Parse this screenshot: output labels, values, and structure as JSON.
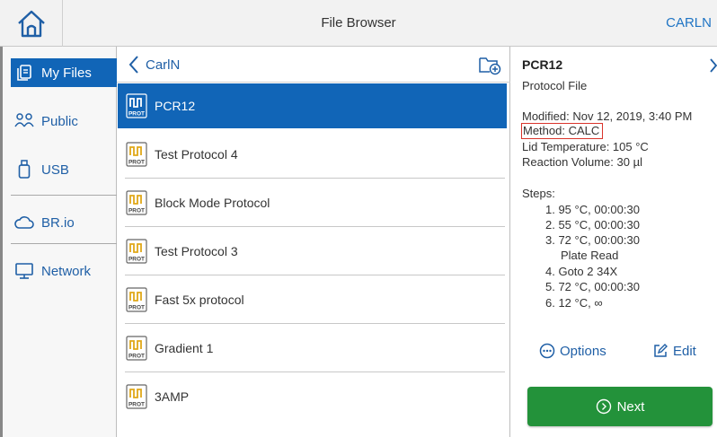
{
  "header": {
    "title": "File Browser",
    "user": "CARLN",
    "home_icon": "home-icon"
  },
  "nav": {
    "items": [
      {
        "label": "My Files",
        "icon": "files-icon",
        "active": true
      },
      {
        "label": "Public",
        "icon": "people-icon",
        "active": false
      },
      {
        "label": "USB",
        "icon": "usb-icon",
        "active": false
      },
      {
        "label": "BR.io",
        "icon": "cloud-icon",
        "active": false
      },
      {
        "label": "Network",
        "icon": "monitor-icon",
        "active": false
      }
    ]
  },
  "list": {
    "back_label": "CarlN",
    "new_folder_icon": "new-folder-icon",
    "badge_text": "PROT",
    "files": [
      {
        "name": "PCR12",
        "selected": true
      },
      {
        "name": "Test Protocol 4",
        "selected": false
      },
      {
        "name": "Block Mode Protocol",
        "selected": false
      },
      {
        "name": "Test Protocol 3",
        "selected": false
      },
      {
        "name": "Fast 5x protocol",
        "selected": false
      },
      {
        "name": "Gradient 1",
        "selected": false
      },
      {
        "name": "3AMP",
        "selected": false
      }
    ]
  },
  "details": {
    "title": "PCR12",
    "type": "Protocol File",
    "modified": "Modified: Nov 12, 2019, 3:40 PM",
    "method": "Method: CALC",
    "lid_temperature": "Lid Temperature: 105 °C",
    "reaction_volume": "Reaction Volume: 30 µl",
    "steps_label": "Steps:",
    "steps": [
      "1.  95 °C, 00:00:30",
      "2.  55 °C, 00:00:30",
      "3.  72 °C, 00:00:30",
      "Plate Read",
      "4.  Goto 2 34X",
      "5.  72 °C, 00:00:30",
      "6.  12 °C, ∞"
    ],
    "options_label": "Options",
    "edit_label": "Edit",
    "next_label": "Next"
  },
  "colors": {
    "accent": "#1165b7",
    "link": "#1f5fa6",
    "next_button": "#23923a",
    "highlight_border": "#d9342b",
    "protocol_icon": "#e0a818"
  }
}
